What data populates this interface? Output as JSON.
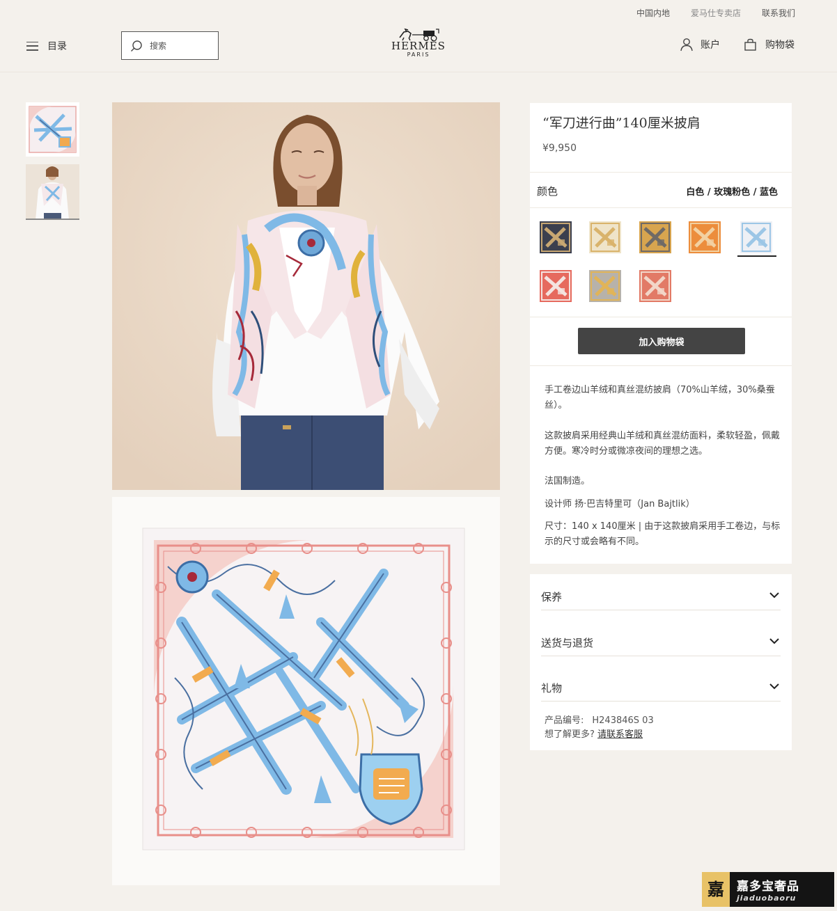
{
  "header": {
    "top_links": [
      "中国内地",
      "爱马仕专卖店",
      "联系我们"
    ],
    "menu_label": "目录",
    "search_placeholder": "搜索",
    "logo_brand": "HERMÈS",
    "logo_city": "PARIS",
    "account_label": "账户",
    "bag_label": "购物袋"
  },
  "product": {
    "title": "“军刀进行曲”140厘米披肩",
    "price": "¥9,950",
    "color_label": "颜色",
    "color_value": "白色 / 玫瑰粉色 / 蓝色",
    "swatches": [
      {
        "name": "navy",
        "base": "#3b3f4e",
        "accent": "#c8a772"
      },
      {
        "name": "cream-gold",
        "base": "#efe4c9",
        "accent": "#d9b36b"
      },
      {
        "name": "gold-grey",
        "base": "#d8a54f",
        "accent": "#6f6a66"
      },
      {
        "name": "orange",
        "base": "#ec8d3c",
        "accent": "#f2d1a2"
      },
      {
        "name": "white-pink-blue",
        "base": "#eef0f5",
        "accent": "#9cc6e6"
      },
      {
        "name": "red-white",
        "base": "#e66a5e",
        "accent": "#f4e4e0"
      },
      {
        "name": "grey-gold",
        "base": "#b7b2aa",
        "accent": "#e1b458"
      },
      {
        "name": "coral",
        "base": "#e27a66",
        "accent": "#f2d6c8"
      }
    ],
    "selected_swatch": 4,
    "add_to_bag_label": "加入购物袋",
    "description": [
      "手工卷边山羊绒和真丝混纺披肩（70%山羊绒，30%桑蚕丝）。",
      "这款披肩采用经典山羊绒和真丝混纺面料，柔软轻盈，佩戴方便。寒冷时分或微凉夜间的理想之选。",
      "法国制造。",
      "设计师 扬·巴吉特里可（Jan Bajtlik）",
      "尺寸：140 x 140厘米 | 由于这款披肩采用手工卷边，与标示的尺寸或会略有不同。"
    ],
    "accordion": [
      "保养",
      "送货与退货",
      "礼物"
    ],
    "sku_label": "产品编号:",
    "sku_value": "H243846S 03",
    "more_label": "想了解更多?",
    "more_link": "请联系客服"
  },
  "colors": {
    "page_bg": "#f4f1ec",
    "button_bg": "#444444",
    "scarf_pink": "#f2c7c2",
    "scarf_blue": "#7fb9e6"
  },
  "watermark": {
    "logo_char": "嘉",
    "name": "嘉多宝奢品",
    "site": "jiaduobaoru"
  }
}
